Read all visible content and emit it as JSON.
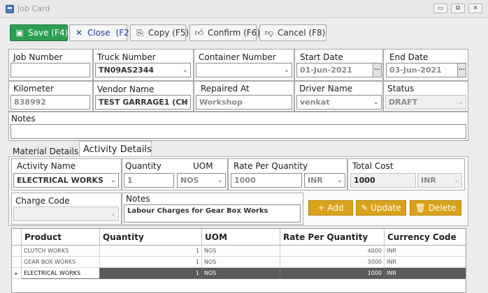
{
  "window": {
    "title": "Job Card",
    "controls": {
      "minimize": "▭",
      "restore": "⧉",
      "close": "✕"
    }
  },
  "toolbar": {
    "save": {
      "label": "Save (F4)",
      "icon": "floppy-icon"
    },
    "close": {
      "label": "Close",
      "shortcut": "(F2)",
      "icon": "x-icon"
    },
    "copy": {
      "label": "Copy (F5)",
      "icon": "copy-icon"
    },
    "confirm": {
      "label": "Confirm (F6)",
      "icon": "thumbs-up-icon"
    },
    "cancel": {
      "label": "Cancel (F8)",
      "icon": "thumbs-down-icon"
    }
  },
  "form": {
    "job_number": {
      "label": "Job Number",
      "value": ""
    },
    "truck_number": {
      "label": "Truck Number",
      "value": "TN09AS2344"
    },
    "container_number": {
      "label": "Container Number",
      "value": ""
    },
    "start_date": {
      "label": "Start Date",
      "value": "01-Jun-2021"
    },
    "end_date": {
      "label": "End Date",
      "value": "03-Jun-2021"
    },
    "kilometer": {
      "label": "Kilometer",
      "value": "838992"
    },
    "vendor_name": {
      "label": "Vendor Name",
      "value": "TEST GARRAGE1 (CH"
    },
    "repaired_at": {
      "label": "Repaired At",
      "value": "Workshop"
    },
    "driver_name": {
      "label": "Driver Name",
      "value": "venkat"
    },
    "status": {
      "label": "Status",
      "value": "DRAFT"
    },
    "notes": {
      "label": "Notes",
      "value": ""
    }
  },
  "tabs": [
    {
      "label": "Material Details",
      "active": false
    },
    {
      "label": "Activity Details",
      "active": true
    }
  ],
  "activity": {
    "activity_name": {
      "label": "Activity Name",
      "value": "ELECTRICAL WORKS"
    },
    "quantity": {
      "label": "Quantity",
      "value": "1"
    },
    "uom": {
      "label": "UOM",
      "value": "NOS"
    },
    "rate_per_quantity": {
      "label": "Rate Per Quantity",
      "value": "1000",
      "currency": "INR"
    },
    "total_cost": {
      "label": "Total Cost",
      "value": "1000",
      "currency": "INR"
    },
    "charge_code": {
      "label": "Charge Code",
      "value": ""
    },
    "notes": {
      "label": "Notes",
      "value": "Labour Charges for Gear Box Works"
    },
    "buttons": {
      "add": "+ Add",
      "update": "Update",
      "delete": "Delete"
    }
  },
  "grid": {
    "columns": [
      "Product",
      "Quantity",
      "UOM",
      "Rate Per Quantity",
      "Currency Code"
    ],
    "rows": [
      {
        "product": "CLUTCH WORKS",
        "quantity": "1",
        "uom": "NOS",
        "rate": "4000",
        "currency": "INR",
        "selected": false
      },
      {
        "product": "GEAR BOX WORKS",
        "quantity": "1",
        "uom": "NOS",
        "rate": "3000",
        "currency": "INR",
        "selected": false
      },
      {
        "product": "ELECTRICAL WORKS",
        "quantity": "1",
        "uom": "NOS",
        "rate": "1000",
        "currency": "INR",
        "selected": true
      }
    ],
    "row_marker": "▸"
  },
  "colors": {
    "save_button": "#2c9e51",
    "action_button": "#d9a21b",
    "selected_row": "#5a5a5a"
  }
}
